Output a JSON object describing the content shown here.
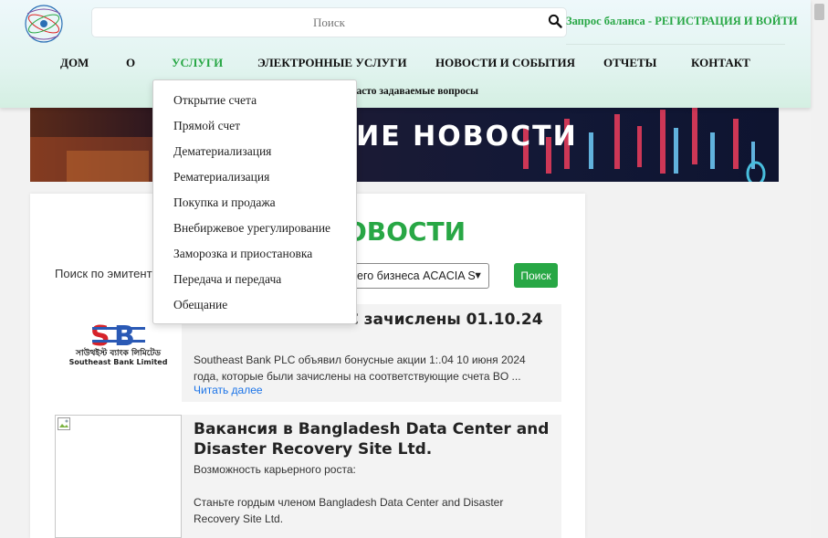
{
  "header": {
    "search_placeholder": "Поиск",
    "balance_link": "Запрос баланса - РЕГИСТРАЦИЯ И ВОЙТИ"
  },
  "nav": {
    "items": [
      "ДОМ",
      "О",
      "УСЛУГИ",
      "ЭЛЕКТРОННЫЕ УСЛУГИ",
      "НОВОСТИ И СОБЫТИЯ",
      "ОТЧЕТЫ",
      "КОНТАКТ"
    ],
    "active_index": 2,
    "faq": "Часто задаваемые вопросы"
  },
  "dropdown": {
    "items": [
      "Открытие счета",
      "Прямой счет",
      "Дематериализация",
      "Рематериализация",
      "Покупка и продажа",
      "Внебиржевое урегулирование",
      "Заморозка и приостановка",
      "Передача и передача",
      "Обещание"
    ]
  },
  "banner": {
    "title": "НИЕ НОВОСТИ"
  },
  "card": {
    "title": "ОВОСТИ",
    "filter_label": "Поиск по эмитенту",
    "filter_value": "его бизнеса ACACIA S",
    "filter_button": "Поиск"
  },
  "news": [
    {
      "title_bold": "",
      "title": "outheast Bank PLC зачислены 01.10.24",
      "text": "Southeast Bank PLC объявил бонусные акции 1:.04 10 июня 2024 года, которые были зачислены на соответствующие счета BO ...",
      "read_more": "Читать далее",
      "logo_bn": "সাউথইস্ট ব্যাংক লিমিটেড",
      "logo_en": "Southeast Bank Limited"
    },
    {
      "title_bold": "Вакансия в",
      "title": "Bangladesh Data Center and Disaster Recovery Site Ltd.",
      "text": "Возможность карьерного роста:",
      "text2": "Станьте гордым членом Bangladesh Data Center and Disaster Recovery Site Ltd."
    }
  ],
  "colors": {
    "accent": "#28a745",
    "link": "#1a73e8"
  }
}
